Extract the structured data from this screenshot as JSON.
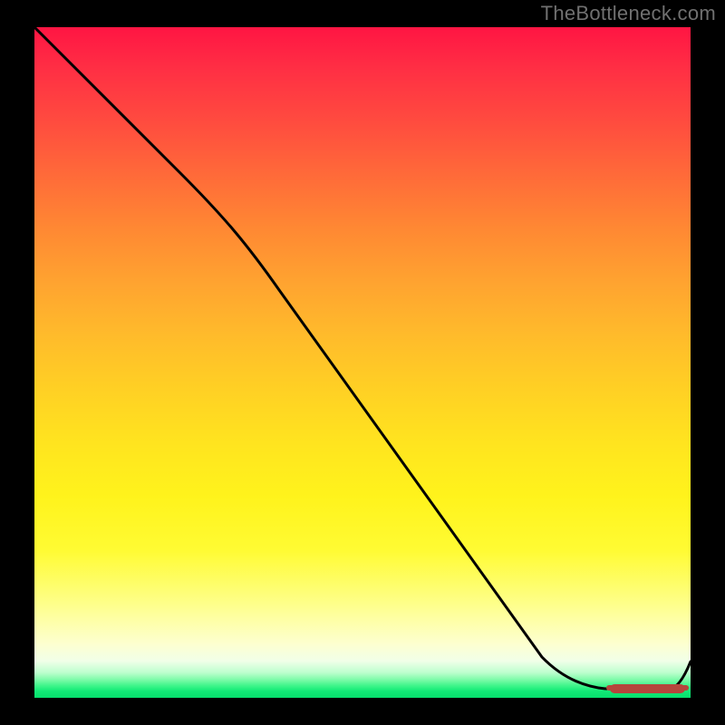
{
  "attribution": "TheBottleneck.com",
  "colors": {
    "background": "#000000",
    "gradient_top": "#ff1543",
    "gradient_mid": "#ffe41f",
    "gradient_bottom": "#06e06d",
    "line": "#000000",
    "marker": "#b5463c"
  },
  "chart_data": {
    "type": "line",
    "title": "",
    "xlabel": "",
    "ylabel": "",
    "xlim": [
      0,
      100
    ],
    "ylim": [
      0,
      100
    ],
    "series": [
      {
        "name": "bottleneck-curve",
        "x": [
          0,
          12,
          26,
          38,
          50,
          62,
          74,
          84,
          90,
          96,
          100
        ],
        "y": [
          100,
          89,
          78,
          62,
          45,
          29,
          13,
          2,
          1,
          1,
          7
        ]
      }
    ],
    "optimal_region": {
      "x_start": 84,
      "x_end": 96,
      "y": 1
    },
    "annotations": []
  }
}
